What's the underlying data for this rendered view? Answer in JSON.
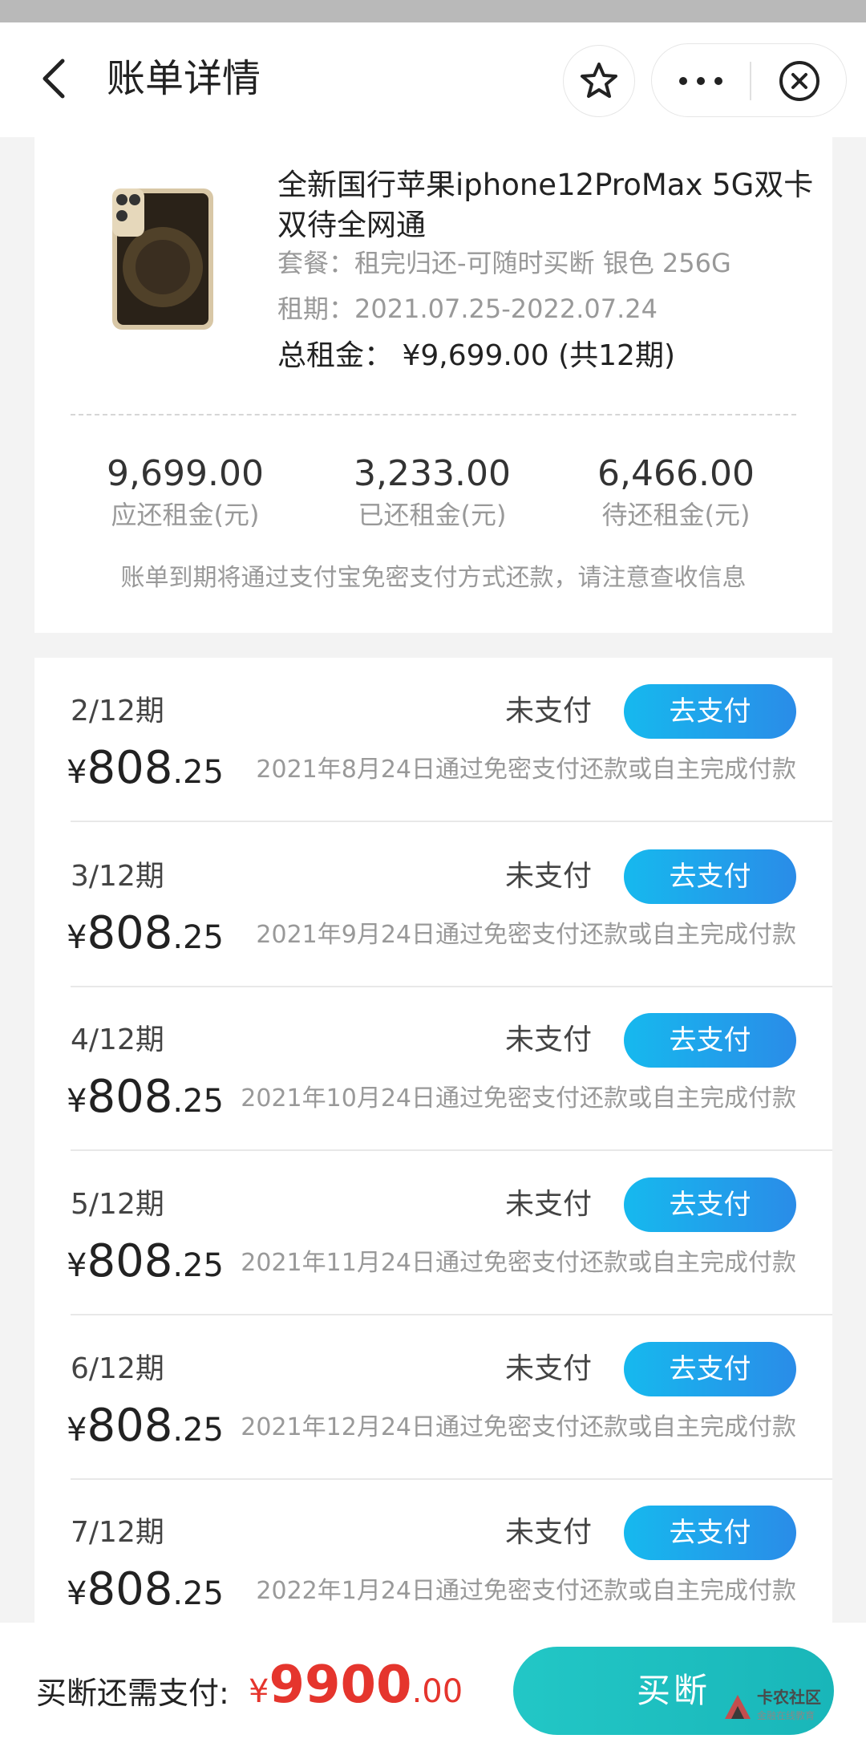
{
  "header": {
    "title": "账单详情",
    "back_icon": "chevron-left-icon",
    "star_icon": "star-icon",
    "more_icon": "more-dots-icon",
    "close_icon": "close-circle-icon"
  },
  "product": {
    "title": "全新国行苹果iphone12ProMax 5G双卡双待全网通",
    "package": "套餐：租完归还-可随时买断 银色 256G",
    "term": "租期：2021.07.25-2022.07.24",
    "total": "总租金： ¥9,699.00 (共12期)"
  },
  "stats": [
    {
      "value": "9,699.00",
      "label": "应还租金(元)"
    },
    {
      "value": "3,233.00",
      "label": "已还租金(元)"
    },
    {
      "value": "6,466.00",
      "label": "待还租金(元)"
    }
  ],
  "notice": "账单到期将通过支付宝免密支付方式还款，请注意查收信息",
  "installments": [
    {
      "period": "2/12期",
      "status": "未支付",
      "button": "去支付",
      "currency": "¥",
      "amount_int": "808",
      "amount_dec": ".25",
      "note": "2021年8月24日通过免密支付还款或自主完成付款"
    },
    {
      "period": "3/12期",
      "status": "未支付",
      "button": "去支付",
      "currency": "¥",
      "amount_int": "808",
      "amount_dec": ".25",
      "note": "2021年9月24日通过免密支付还款或自主完成付款"
    },
    {
      "period": "4/12期",
      "status": "未支付",
      "button": "去支付",
      "currency": "¥",
      "amount_int": "808",
      "amount_dec": ".25",
      "note": "2021年10月24日通过免密支付还款或自主完成付款"
    },
    {
      "period": "5/12期",
      "status": "未支付",
      "button": "去支付",
      "currency": "¥",
      "amount_int": "808",
      "amount_dec": ".25",
      "note": "2021年11月24日通过免密支付还款或自主完成付款"
    },
    {
      "period": "6/12期",
      "status": "未支付",
      "button": "去支付",
      "currency": "¥",
      "amount_int": "808",
      "amount_dec": ".25",
      "note": "2021年12月24日通过免密支付还款或自主完成付款"
    },
    {
      "period": "7/12期",
      "status": "未支付",
      "button": "去支付",
      "currency": "¥",
      "amount_int": "808",
      "amount_dec": ".25",
      "note": "2022年1月24日通过免密支付还款或自主完成付款"
    }
  ],
  "footer": {
    "remain_label": "买断还需支付:",
    "currency": "¥",
    "amount_int": "9900",
    "amount_dec": ".00",
    "buyout_button": "买断",
    "watermark_title": "卡农社区",
    "watermark_sub": "金融在线教育"
  },
  "colors": {
    "accent_blue": "#1fa9ec",
    "accent_teal": "#1fbfbf",
    "price_red": "#e5352d"
  }
}
